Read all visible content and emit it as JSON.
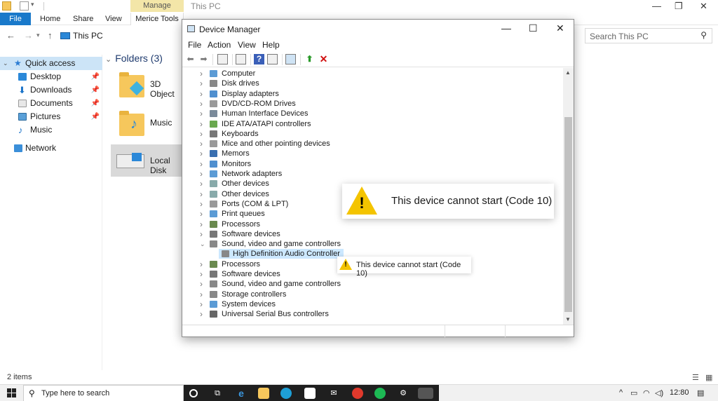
{
  "explorer": {
    "window_title": "This PC",
    "manage_tab": "Manage",
    "ribbon_tabs": [
      "File",
      "Home",
      "Share",
      "View",
      "Merice Tools"
    ],
    "address": "This PC",
    "search_placeholder": "Search This PC",
    "nav": {
      "quick_access": "Quick access",
      "items": [
        "Desktop",
        "Downloads",
        "Documents",
        "Pictures",
        "Music"
      ],
      "network": "Network"
    },
    "folders_header": "Folders (3)",
    "tiles": [
      "3D Object",
      "Music",
      "Local Disk"
    ],
    "status": "2 items"
  },
  "device_manager": {
    "title": "Device Manager",
    "menu": [
      "File",
      "Action",
      "View",
      "Help"
    ],
    "tree": [
      "Computer",
      "Disk drives",
      "Display adapters",
      "DVD/CD-ROM Drives",
      "Human Interface Devices",
      "IDE ATA/ATAPI controllers",
      "Keyboards",
      "Mice and other pointing devices",
      "Memors",
      "Monitors",
      "Network adapters",
      "Other devices",
      "Other devices",
      "Ports (COM & LPT)",
      "Print queues",
      "Processors",
      "Software devices",
      "Sound, video and game controllers",
      "High Definition Audio Controller",
      "Processors",
      "Software devices",
      "Sound, video and game controllers",
      "Storage controllers",
      "System devices",
      "Universal Serial Bus controllers"
    ],
    "callout_text": "This device cannot start (Code 10)",
    "tooltip_text": "This device cannot start (Code 10)"
  },
  "taskbar": {
    "search_placeholder": "Type here to search",
    "clock": "12:80"
  },
  "colors": {
    "accent": "#1979ca",
    "warning": "#f4c400",
    "selection": "#cce8ff"
  }
}
